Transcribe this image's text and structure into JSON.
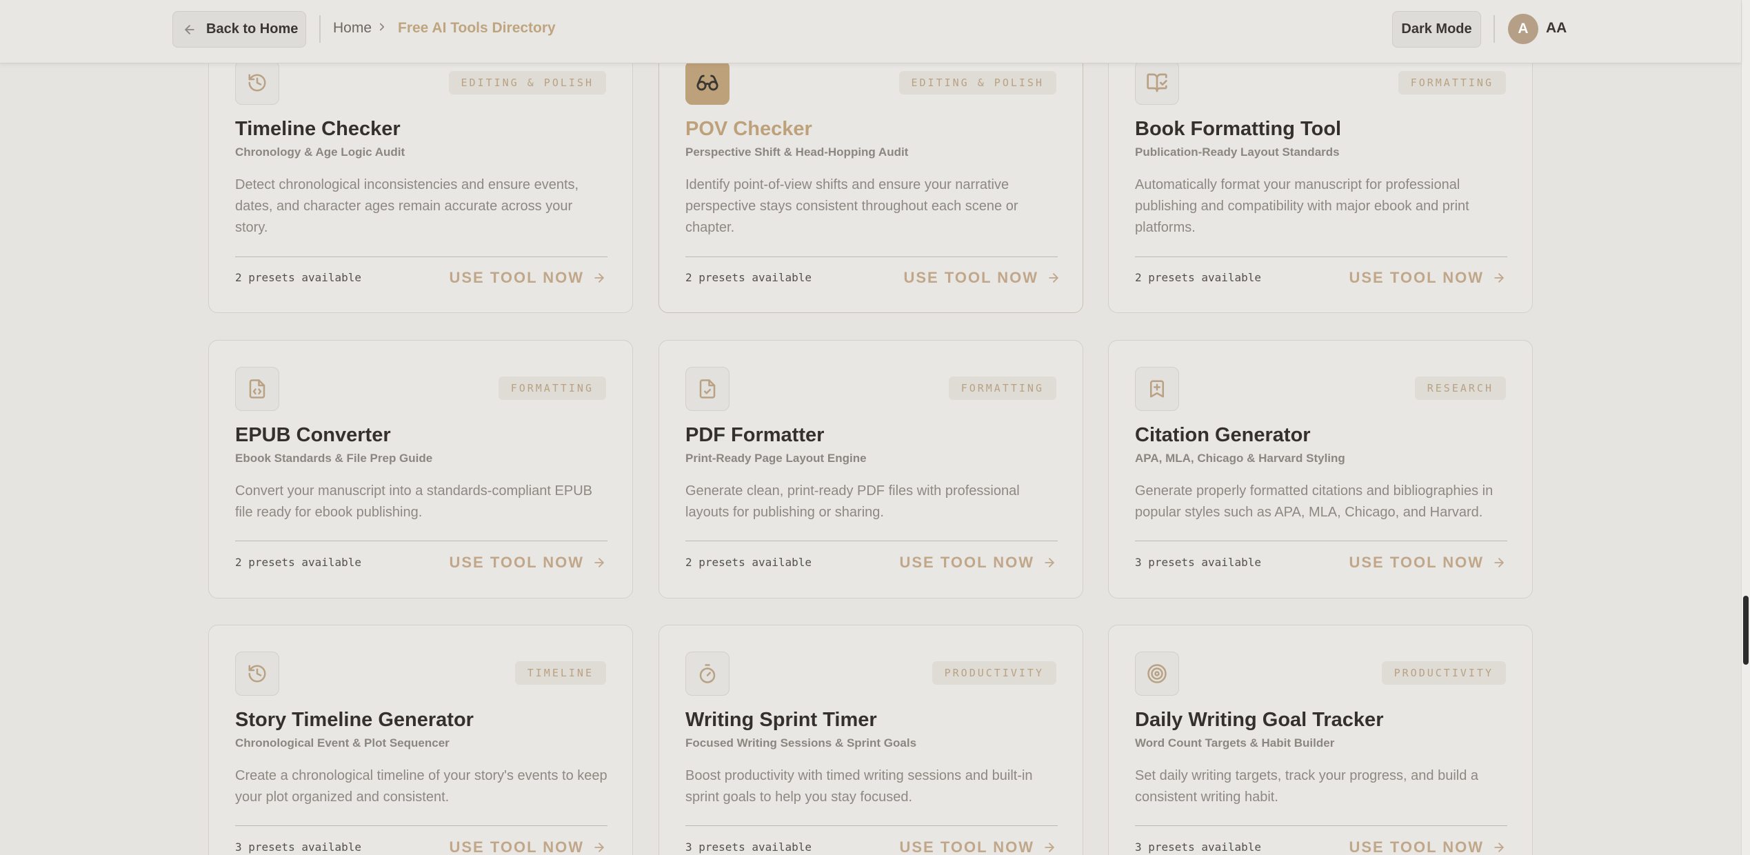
{
  "header": {
    "back_label": "Back to Home",
    "breadcrumb_home": "Home",
    "breadcrumb_current": "Free AI Tools Directory",
    "dark_mode_label": "Dark Mode",
    "avatar_initial": "A",
    "text_size_label": "AA"
  },
  "colors": {
    "accent": "#bda17a",
    "background": "#e6e4e0",
    "card": "#e9e7e3"
  },
  "cards": [
    {
      "icon": "history-icon",
      "badge": "EDITING & POLISH",
      "title": "Timeline Checker",
      "subtitle": "Chronology & Age Logic Audit",
      "description": "Detect chronological inconsistencies and ensure events, dates, and character ages remain accurate across your story.",
      "presets": "2 presets available",
      "cta": "USE TOOL NOW"
    },
    {
      "icon": "glasses-icon",
      "badge": "EDITING & POLISH",
      "title": "POV Checker",
      "subtitle": "Perspective Shift & Head-Hopping Audit",
      "description": "Identify point-of-view shifts and ensure your narrative perspective stays consistent throughout each scene or chapter.",
      "presets": "2 presets available",
      "cta": "USE TOOL NOW"
    },
    {
      "icon": "book-open-check-icon",
      "badge": "FORMATTING",
      "title": "Book Formatting Tool",
      "subtitle": "Publication-Ready Layout Standards",
      "description": "Automatically format your manuscript for professional publishing and compatibility with major ebook and print platforms.",
      "presets": "2 presets available",
      "cta": "USE TOOL NOW"
    },
    {
      "icon": "file-code-icon",
      "badge": "FORMATTING",
      "title": "EPUB Converter",
      "subtitle": "Ebook Standards & File Prep Guide",
      "description": "Convert your manuscript into a standards-compliant EPUB file ready for ebook publishing.",
      "presets": "2 presets available",
      "cta": "USE TOOL NOW"
    },
    {
      "icon": "file-check-icon",
      "badge": "FORMATTING",
      "title": "PDF Formatter",
      "subtitle": "Print-Ready Page Layout Engine",
      "description": "Generate clean, print-ready PDF files with professional layouts for publishing or sharing.",
      "presets": "2 presets available",
      "cta": "USE TOOL NOW"
    },
    {
      "icon": "bookmark-plus-icon",
      "badge": "RESEARCH",
      "title": "Citation Generator",
      "subtitle": "APA, MLA, Chicago & Harvard Styling",
      "description": "Generate properly formatted citations and bibliographies in popular styles such as APA, MLA, Chicago, and Harvard.",
      "presets": "3 presets available",
      "cta": "USE TOOL NOW"
    },
    {
      "icon": "history-icon",
      "badge": "TIMELINE",
      "title": "Story Timeline Generator",
      "subtitle": "Chronological Event & Plot Sequencer",
      "description": "Create a chronological timeline of your story's events to keep your plot organized and consistent.",
      "presets": "3 presets available",
      "cta": "USE TOOL NOW"
    },
    {
      "icon": "timer-icon",
      "badge": "PRODUCTIVITY",
      "title": "Writing Sprint Timer",
      "subtitle": "Focused Writing Sessions & Sprint Goals",
      "description": "Boost productivity with timed writing sessions and built-in sprint goals to help you stay focused.",
      "presets": "3 presets available",
      "cta": "USE TOOL NOW"
    },
    {
      "icon": "target-icon",
      "badge": "PRODUCTIVITY",
      "title": "Daily Writing Goal Tracker",
      "subtitle": "Word Count Targets & Habit Builder",
      "description": "Set daily writing targets, track your progress, and build a consistent writing habit.",
      "presets": "3 presets available",
      "cta": "USE TOOL NOW"
    }
  ]
}
